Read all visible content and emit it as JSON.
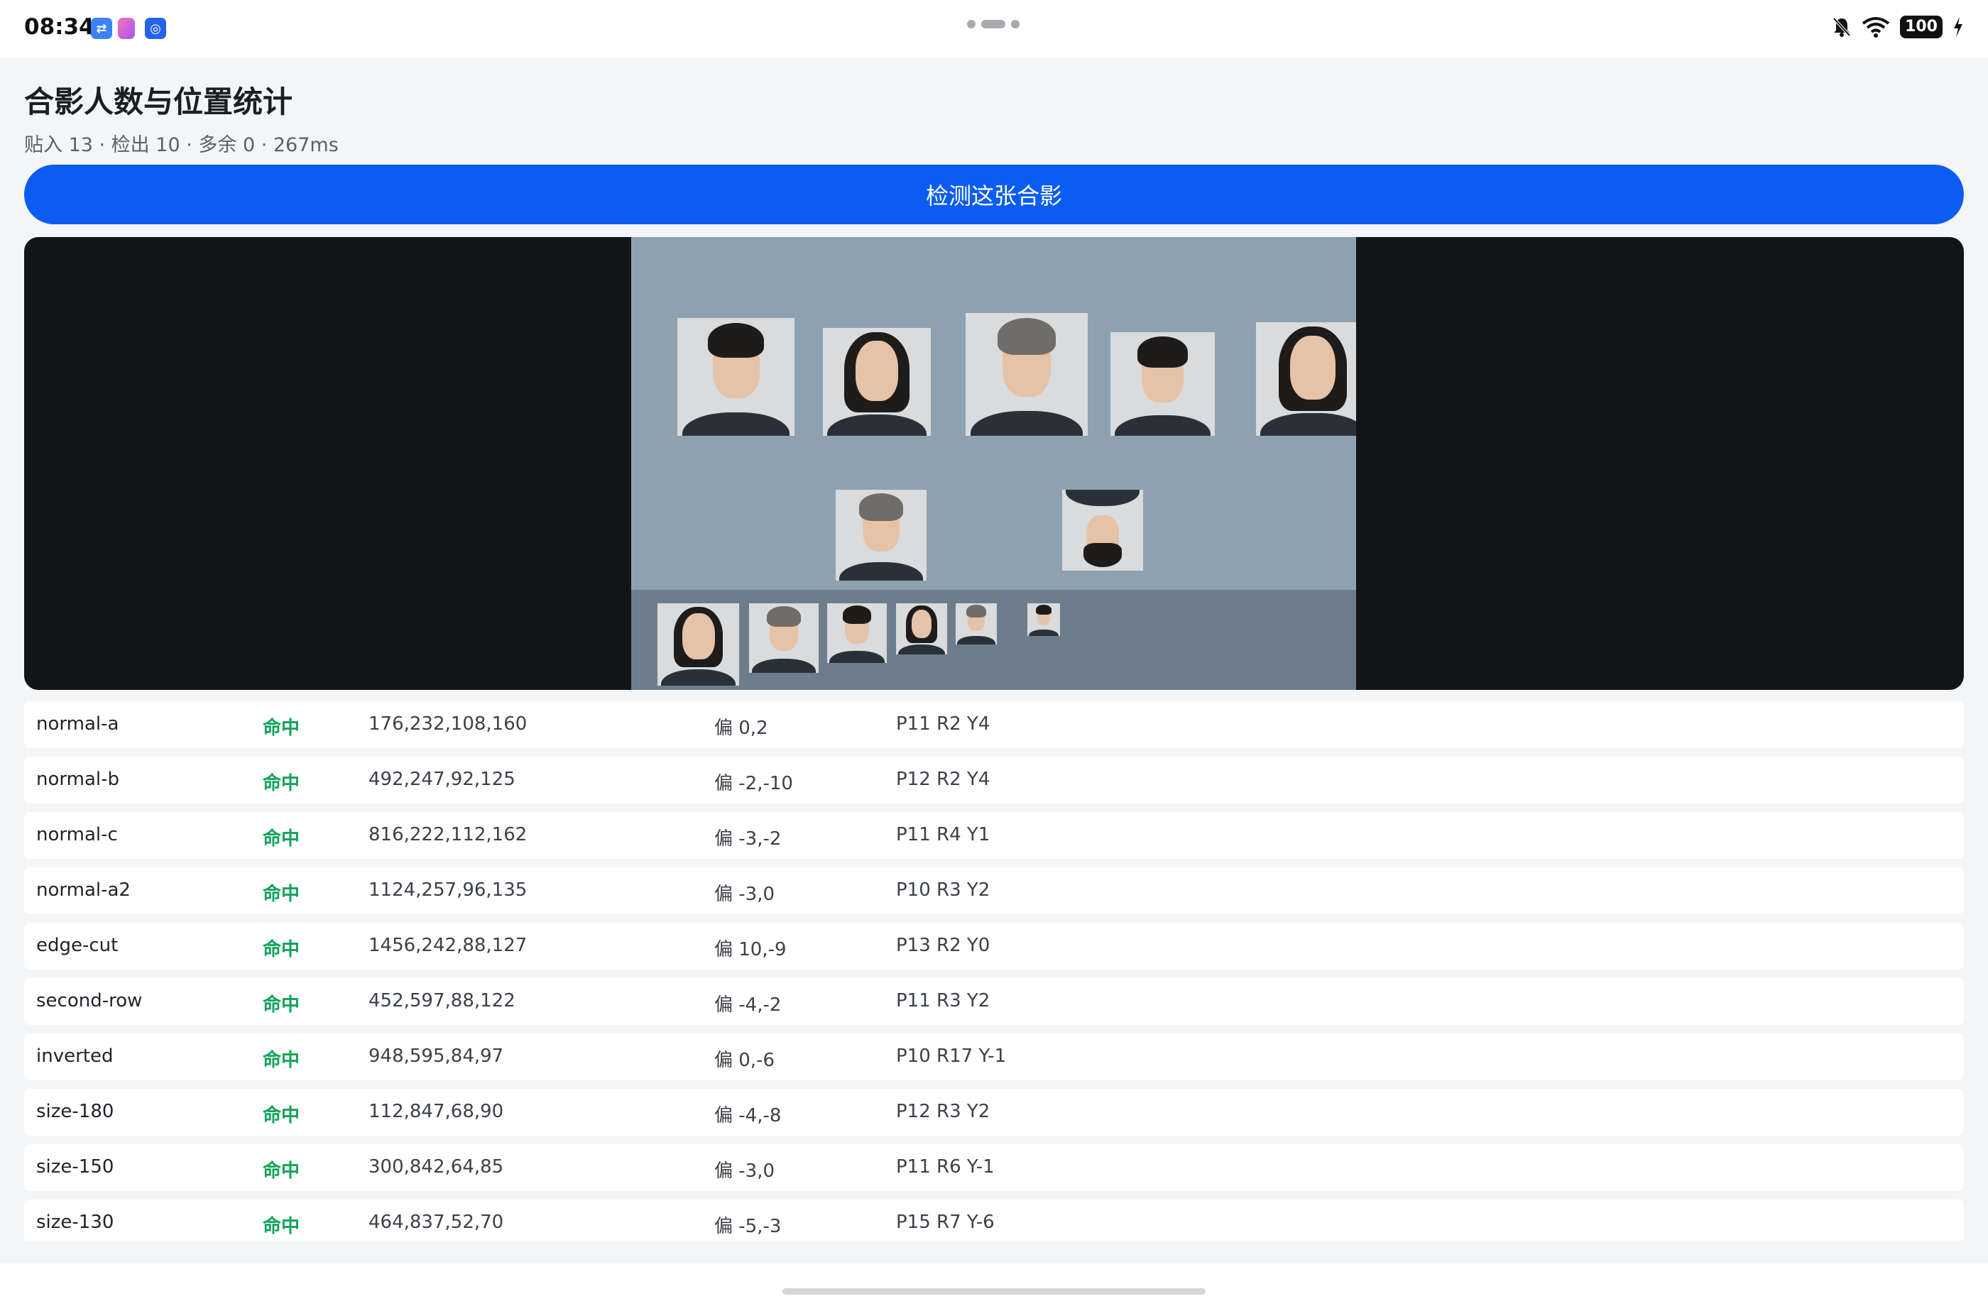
{
  "status_bar": {
    "time": "08:34",
    "battery": "100",
    "icons": [
      "usb-icon",
      "app-icon",
      "assistant-icon",
      "dnd-bell-icon",
      "wifi-icon",
      "charging-icon"
    ]
  },
  "header": {
    "title": "合影人数与位置统计",
    "summary": "贴入 13 · 检出 10 · 多余 0 · 267ms"
  },
  "actions": {
    "detect_label": "检测这张合影"
  },
  "results": [
    {
      "name": "normal-a",
      "status": "命中",
      "box": "176,232,108,160",
      "offset": "偏 0,2",
      "pose": "P11 R2 Y4"
    },
    {
      "name": "normal-b",
      "status": "命中",
      "box": "492,247,92,125",
      "offset": "偏 -2,-10",
      "pose": "P12 R2 Y4"
    },
    {
      "name": "normal-c",
      "status": "命中",
      "box": "816,222,112,162",
      "offset": "偏 -3,-2",
      "pose": "P11 R4 Y1"
    },
    {
      "name": "normal-a2",
      "status": "命中",
      "box": "1124,257,96,135",
      "offset": "偏 -3,0",
      "pose": "P10 R3 Y2"
    },
    {
      "name": "edge-cut",
      "status": "命中",
      "box": "1456,242,88,127",
      "offset": "偏 10,-9",
      "pose": "P13 R2 Y0"
    },
    {
      "name": "second-row",
      "status": "命中",
      "box": "452,597,88,122",
      "offset": "偏 -4,-2",
      "pose": "P11 R3 Y2"
    },
    {
      "name": "inverted",
      "status": "命中",
      "box": "948,595,84,97",
      "offset": "偏 0,-6",
      "pose": "P10 R17 Y-1"
    },
    {
      "name": "size-180",
      "status": "命中",
      "box": "112,847,68,90",
      "offset": "偏 -4,-8",
      "pose": "P12 R3 Y2"
    },
    {
      "name": "size-150",
      "status": "命中",
      "box": "300,842,64,85",
      "offset": "偏 -3,0",
      "pose": "P11 R6 Y-1"
    },
    {
      "name": "size-130",
      "status": "命中",
      "box": "464,837,52,70",
      "offset": "偏 -5,-3",
      "pose": "P15 R7 Y-6"
    }
  ],
  "colors": {
    "accent": "#0b5cf2",
    "hit": "#11a35a",
    "photo_bg": "#8ea1b1",
    "viewer_bg": "#131416"
  }
}
